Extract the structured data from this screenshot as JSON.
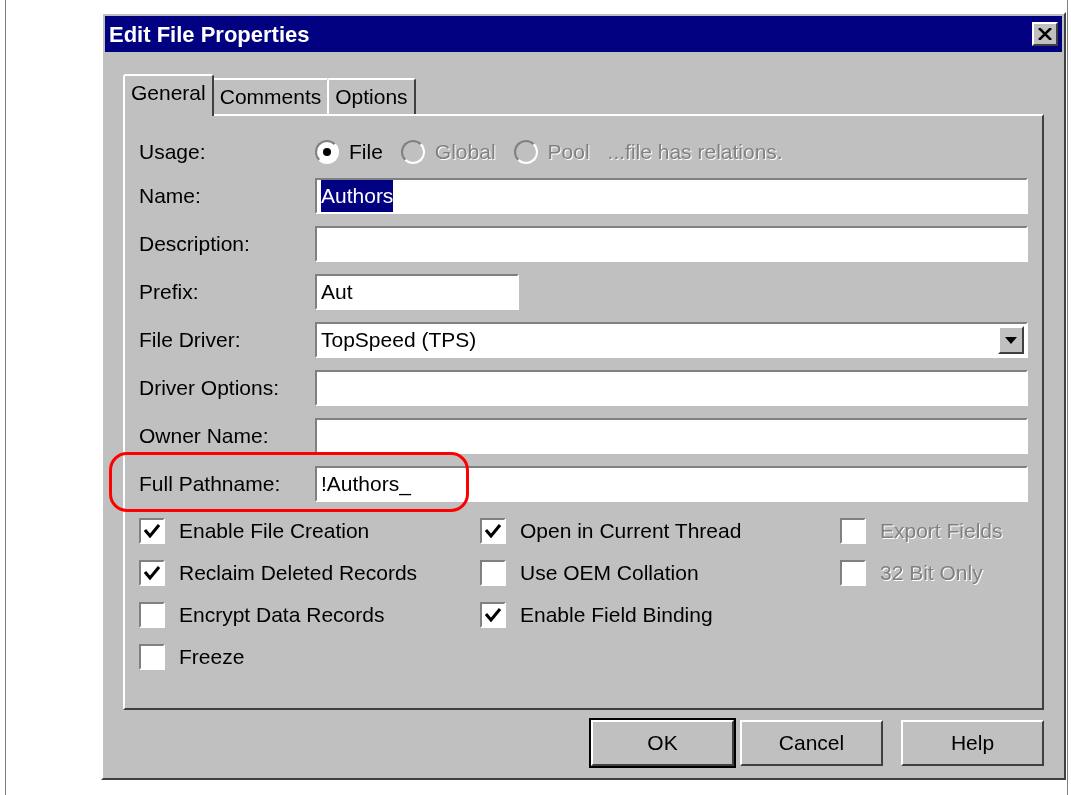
{
  "window": {
    "title": "Edit File Properties"
  },
  "tabs": [
    {
      "label": "General",
      "selected": true
    },
    {
      "label": "Comments",
      "selected": false
    },
    {
      "label": "Options",
      "selected": false
    }
  ],
  "usage": {
    "label": "Usage:",
    "options": [
      {
        "label": "File",
        "selected": true,
        "disabled": false
      },
      {
        "label": "Global",
        "selected": false,
        "disabled": true
      },
      {
        "label": "Pool",
        "selected": false,
        "disabled": true
      }
    ],
    "note": "...file has relations."
  },
  "fields": [
    {
      "label": "Name:",
      "value": "Authors",
      "kind": "text",
      "value_selected": true,
      "annotated": false
    },
    {
      "label": "Description:",
      "kind": "text",
      "annotated": false
    },
    {
      "label": "Prefix:",
      "value": "Aut",
      "kind": "short",
      "value_selected": false,
      "annotated": false
    },
    {
      "label": "File Driver:",
      "value": "TopSpeed (TPS)",
      "kind": "dropdown",
      "annotated": false
    },
    {
      "label": "Driver Options:",
      "kind": "text",
      "annotated": false
    },
    {
      "label": "Owner Name:",
      "kind": "text",
      "annotated": false
    },
    {
      "label": "Full Pathname:",
      "value": "!Authors_",
      "kind": "text",
      "value_selected": false,
      "annotated": true
    }
  ],
  "checkbox_columns": [
    [
      {
        "label": "Enable File Creation",
        "checked": true,
        "disabled": false
      },
      {
        "label": "Reclaim Deleted Records",
        "checked": true,
        "disabled": false
      },
      {
        "label": "Encrypt Data Records",
        "checked": false,
        "disabled": false
      },
      {
        "label": "Freeze",
        "checked": false,
        "disabled": false
      }
    ],
    [
      {
        "label": "Open in Current Thread",
        "checked": true,
        "disabled": false
      },
      {
        "label": "Use OEM Collation",
        "checked": false,
        "disabled": false
      },
      {
        "label": "Enable Field Binding",
        "checked": true,
        "disabled": false
      }
    ],
    [
      {
        "label": "Export Fields",
        "checked": false,
        "disabled": true
      },
      {
        "label": "32 Bit Only",
        "checked": false,
        "disabled": true
      }
    ]
  ],
  "buttons": [
    {
      "label": "OK",
      "default": true
    },
    {
      "label": "Cancel",
      "default": false
    },
    {
      "label": "Help",
      "default": false
    }
  ]
}
